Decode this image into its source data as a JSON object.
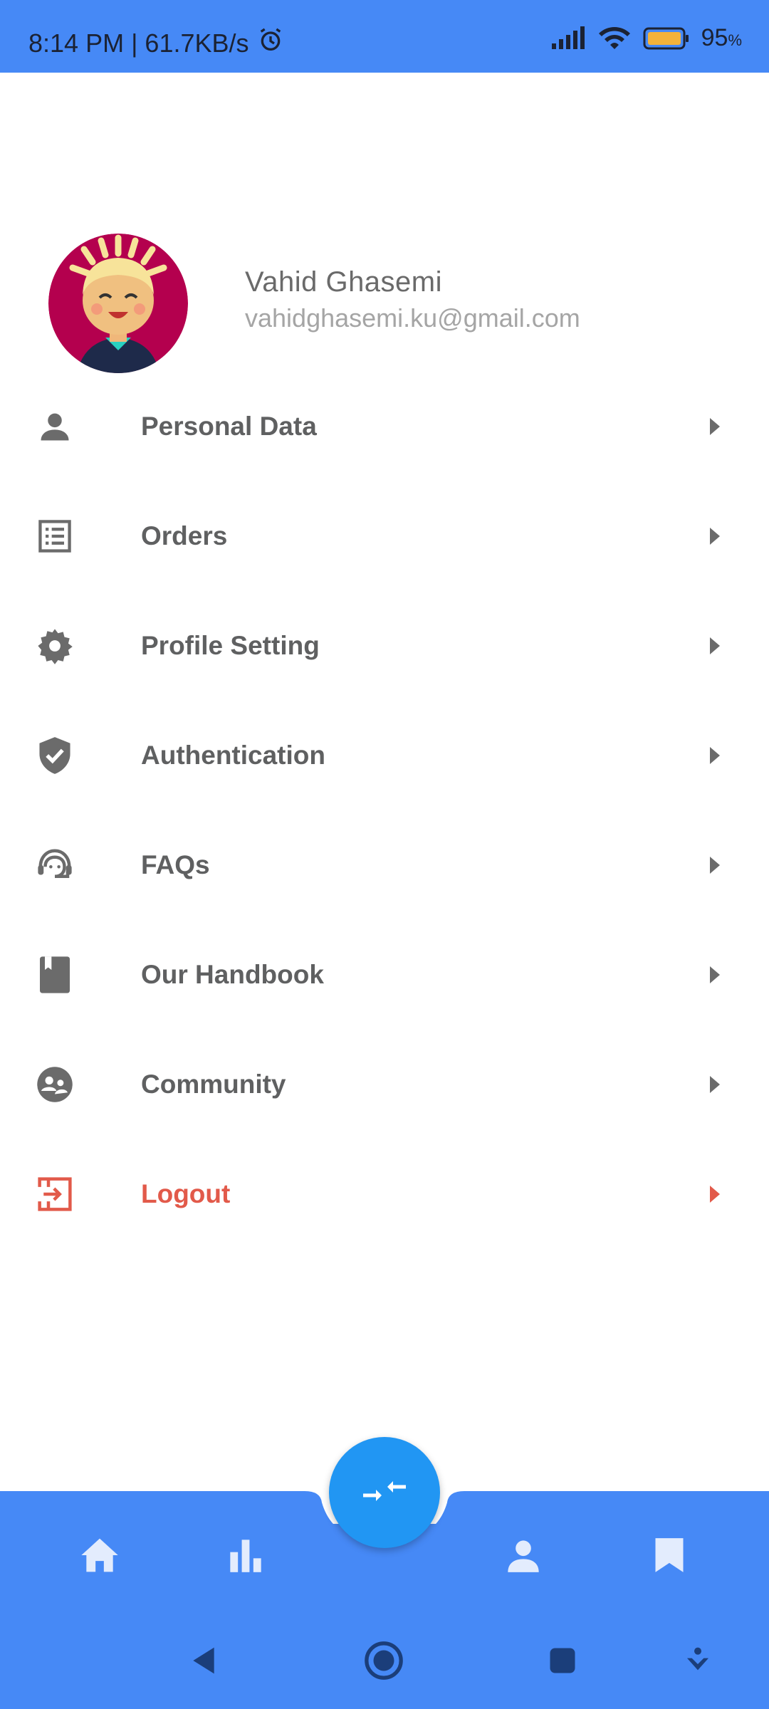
{
  "status_bar": {
    "time_speed": "8:14 PM | 61.7KB/s",
    "battery": "95",
    "battery_unit": "%"
  },
  "profile": {
    "name": "Vahid Ghasemi",
    "email": "vahidghasemi.ku@gmail.com"
  },
  "menu": {
    "items": [
      {
        "label": "Personal Data",
        "icon": "person-icon"
      },
      {
        "label": "Orders",
        "icon": "list-icon"
      },
      {
        "label": "Profile Setting",
        "icon": "gear-icon"
      },
      {
        "label": "Authentication",
        "icon": "shield-check-icon"
      },
      {
        "label": "FAQs",
        "icon": "support-agent-icon"
      },
      {
        "label": "Our Handbook",
        "icon": "book-icon"
      },
      {
        "label": "Community",
        "icon": "community-icon"
      },
      {
        "label": "Logout",
        "icon": "logout-icon"
      }
    ]
  },
  "colors": {
    "primary": "#4689f6",
    "fab": "#2196f3",
    "text": "#5f6061",
    "logout": "#e25a4a"
  },
  "bottom_nav": [
    "home-icon",
    "bar-chart-icon",
    "swap-icon",
    "person-icon",
    "bookmark-icon"
  ]
}
